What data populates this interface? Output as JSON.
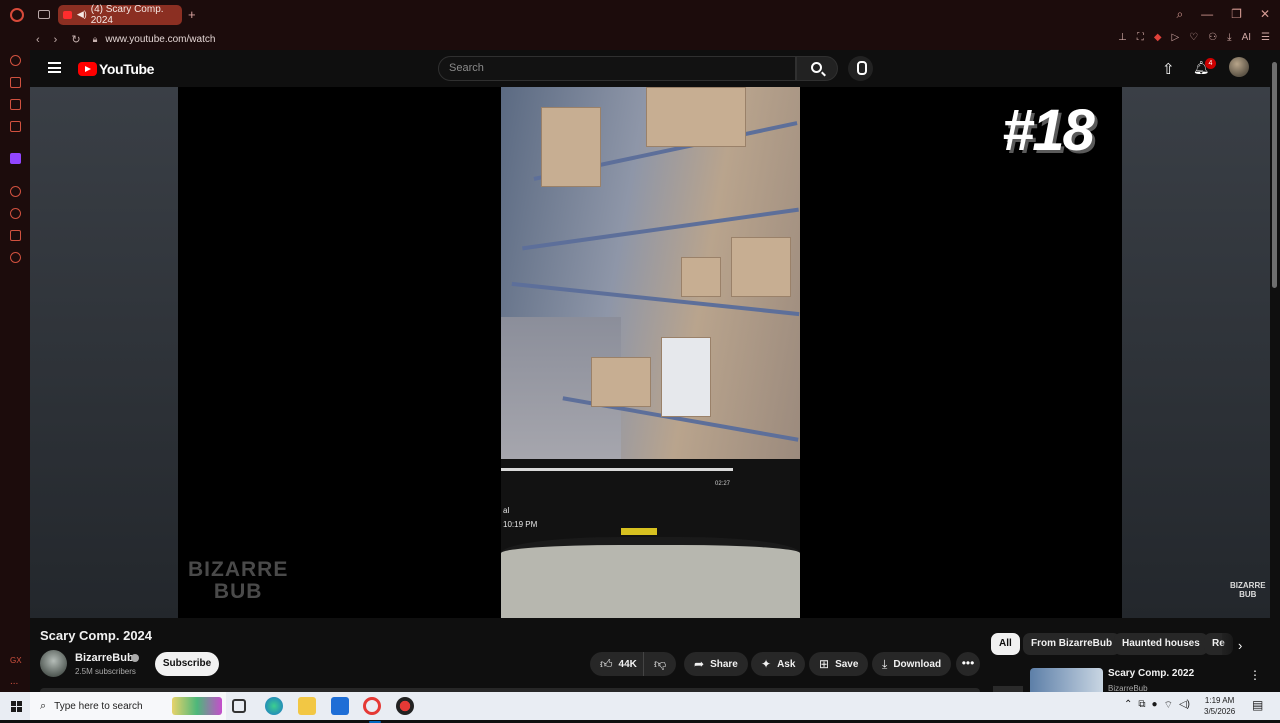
{
  "browser": {
    "tab_title": "(4) Scary Comp. 2024",
    "new_tab": "+",
    "url": "www.youtube.com/watch",
    "sidebar_gx": "GX",
    "sidebar_more": "...",
    "addr_ai": "AI"
  },
  "youtube": {
    "logo_text": "YouTube",
    "search_placeholder": "Search",
    "notification_count": "4"
  },
  "video": {
    "episode_label": "#18",
    "watermark_left_1": "BIZARRE",
    "watermark_left_2": "BUB",
    "watermark_right_1": "BIZARRE",
    "watermark_right_2": "BUB",
    "frame_time_1": "02:27",
    "frame_time_2": "10:19 PM",
    "frame_letter": "al",
    "title": "Scary Comp. 2024"
  },
  "channel": {
    "name": "BizarreBub",
    "subscribers": "2.5M subscribers",
    "subscribe_label": "Subscribe"
  },
  "actions": {
    "likes": "44K",
    "share": "Share",
    "ask": "Ask",
    "save": "Save",
    "download": "Download"
  },
  "chips": [
    "All",
    "From BizarreBub",
    "Haunted houses",
    "Re"
  ],
  "recommendation": {
    "title": "Scary Comp. 2022",
    "channel": "BizarreBub"
  },
  "taskbar": {
    "search_placeholder": "Type here to search",
    "time": "1:19 AM",
    "date": "3/5/2026"
  },
  "colors": {
    "browser_chrome": "#1c0c0c",
    "active_tab": "#8b2f22",
    "youtube_red": "#ff0000",
    "youtube_bg": "#0f0f0f"
  },
  "icons": [
    "opera-logo-icon",
    "search-icon",
    "mic-icon",
    "upload-icon",
    "bell-icon",
    "like-icon",
    "dislike-icon",
    "share-icon",
    "ask-icon",
    "save-icon",
    "download-icon",
    "more-icon",
    "windows-icon"
  ]
}
